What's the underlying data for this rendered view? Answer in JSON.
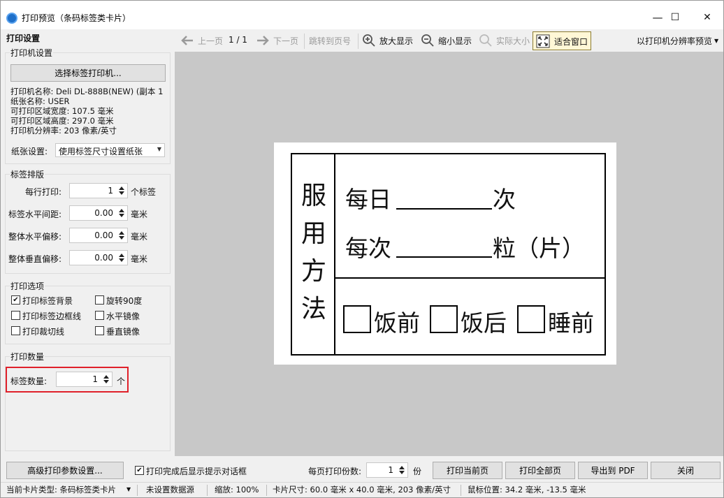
{
  "window": {
    "title": "打印预览（条码标签类卡片）",
    "minimize": "—",
    "maximize": "☐",
    "close": "✕"
  },
  "settings": {
    "title": "打印设置",
    "printer_group": "打印机设置",
    "select_printer": "选择标签打印机...",
    "info": [
      "打印机名称: Deli DL-888B(NEW) (副本 1",
      "纸张名称: USER",
      "可打印区域宽度: 107.5 毫米",
      "可打印区域高度: 297.0 毫米",
      "打印机分辨率: 203 像素/英寸"
    ],
    "paper_label": "纸张设置:",
    "paper_value": "使用标签尺寸设置纸张",
    "layout_group": "标签排版",
    "per_row_label": "每行打印:",
    "per_row_value": "1",
    "per_row_unit": "个标签",
    "hspacing_label": "标签水平间距:",
    "hspacing_value": "0.00",
    "hoffset_label": "整体水平偏移:",
    "hoffset_value": "0.00",
    "voffset_label": "整体垂直偏移:",
    "voffset_value": "0.00",
    "mm": "毫米",
    "options_group": "打印选项",
    "options": [
      {
        "label": "打印标签背景",
        "checked": true
      },
      {
        "label": "旋转90度",
        "checked": false
      },
      {
        "label": "打印标签边框线",
        "checked": false
      },
      {
        "label": "水平镜像",
        "checked": false
      },
      {
        "label": "打印裁切线",
        "checked": false
      },
      {
        "label": "垂直镜像",
        "checked": false
      }
    ],
    "count_group": "打印数量",
    "count_label": "标签数量:",
    "count_value": "1",
    "count_unit": "个"
  },
  "toolbar": {
    "prev": "上一页",
    "page": "1 / 1",
    "next": "下一页",
    "goto": "跳转到页号",
    "zoom_in": "放大显示",
    "zoom_out": "缩小显示",
    "actual": "实际大小",
    "fit": "适合窗口",
    "resolution": "以打印机分辨率预览"
  },
  "label": {
    "vertical": [
      "服",
      "用",
      "方",
      "法"
    ],
    "line1_a": "每日",
    "line1_b": "次",
    "line2_a": "每次",
    "line2_b": "粒（片）",
    "opt1": "饭前",
    "opt2": "饭后",
    "opt3": "睡前"
  },
  "bottom": {
    "advanced": "高级打印参数设置...",
    "show_dialog": "打印完成后显示提示对话框",
    "show_dialog_checked": true,
    "copies_label": "每页打印份数:",
    "copies_value": "1",
    "copies_unit": "份",
    "print_current": "打印当前页",
    "print_all": "打印全部页",
    "export_pdf": "导出到 PDF",
    "close": "关闭"
  },
  "status": {
    "card_type": "当前卡片类型: 条码标签类卡片",
    "datasource": "未设置数据源",
    "zoom": "缩放: 100%",
    "card_size": "卡片尺寸: 60.0 毫米 x 40.0 毫米, 203 像素/英寸",
    "mouse": "鼠标位置: 34.2 毫米, -13.5 毫米"
  },
  "colors": {
    "highlight": "#e0202a",
    "accent": "#1e6fc9"
  }
}
